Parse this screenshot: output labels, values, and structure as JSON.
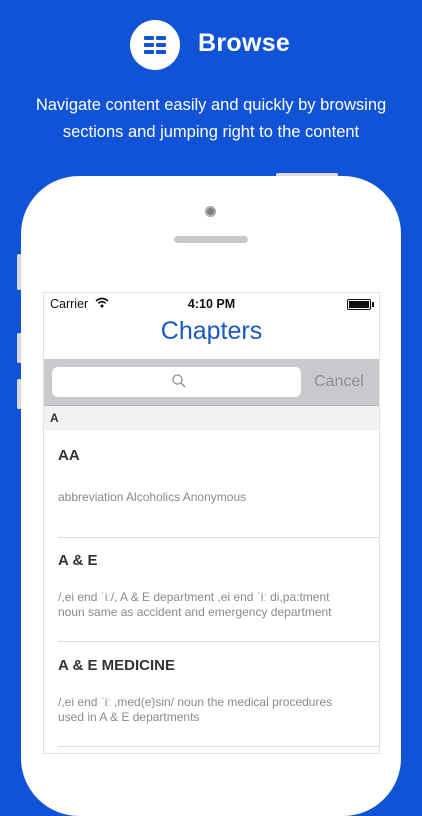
{
  "header": {
    "icon": "list-icon",
    "title": "Browse",
    "subtitle_line1": "Navigate content easily and quickly by browsing",
    "subtitle_line2": "sections and jumping right to the content"
  },
  "status_bar": {
    "carrier": "Carrier",
    "time": "4:10 PM"
  },
  "nav": {
    "title": "Chapters"
  },
  "search": {
    "placeholder": "",
    "cancel_label": "Cancel"
  },
  "section": {
    "letter": "A"
  },
  "entries": [
    {
      "term": "AA",
      "definition_line1": "abbreviation Alcoholics Anonymous",
      "definition_line2": ""
    },
    {
      "term": "A & E",
      "definition_line1": "/,ei end ˈiː/, A & E department ,ei end ˈiː di,pa:tment",
      "definition_line2": "noun same as accident and emergency department"
    },
    {
      "term": "A & E MEDICINE",
      "definition_line1": "/,ei end ˈiː ,med(e)sin/ noun the medical procedures",
      "definition_line2": "used in A & E departments"
    }
  ],
  "colors": {
    "background": "#1153d6",
    "accent": "#1a58c4"
  }
}
